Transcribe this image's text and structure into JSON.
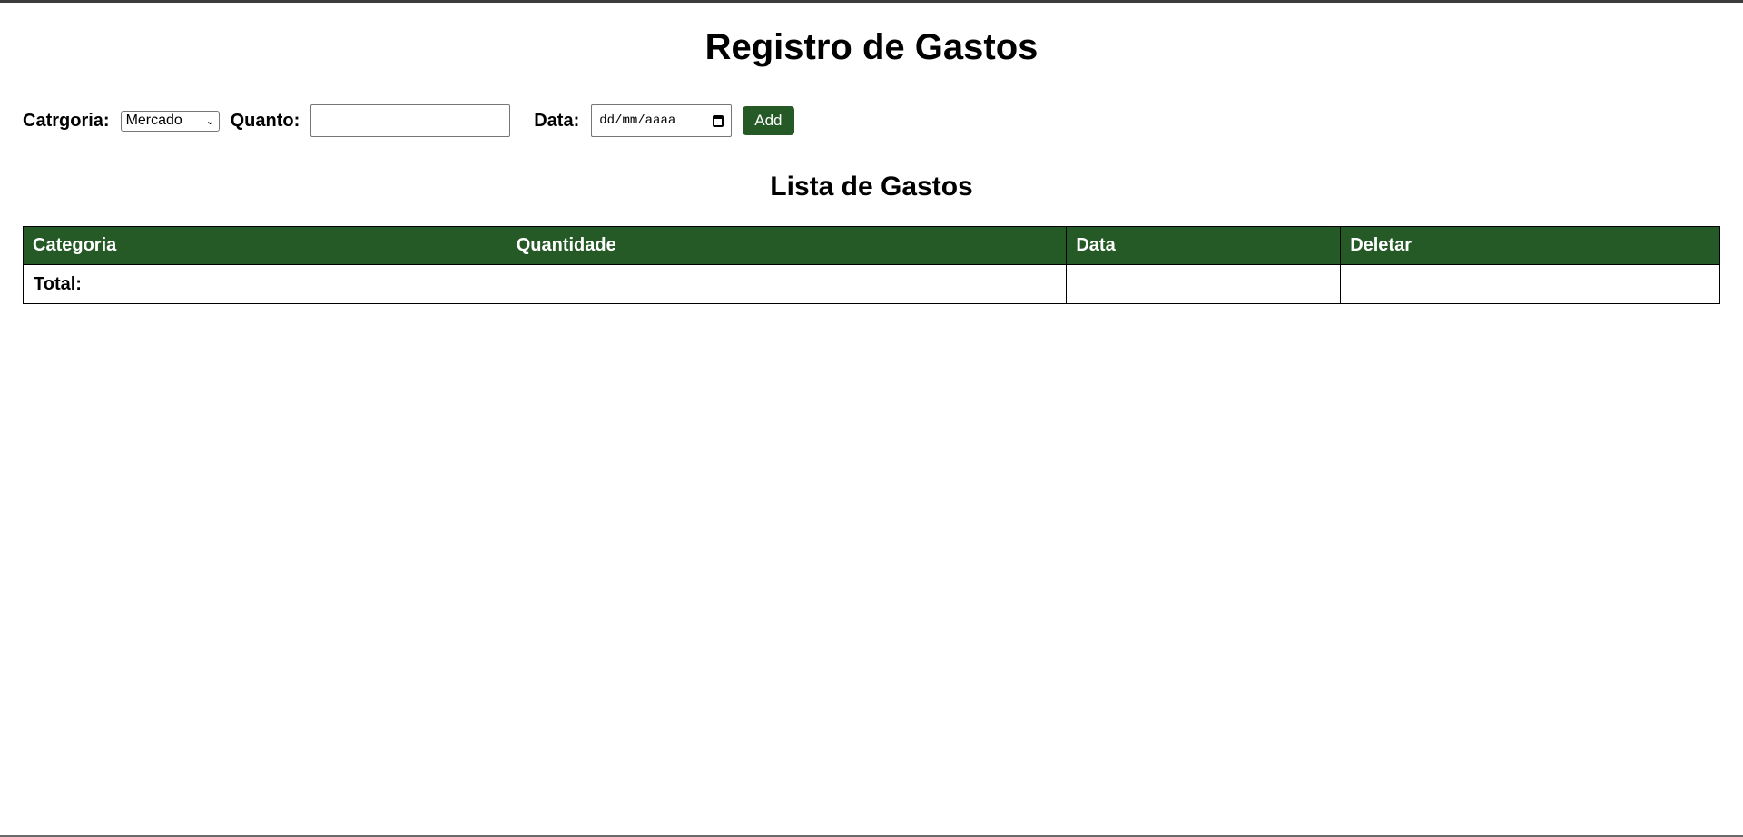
{
  "page": {
    "title": "Registro de Gastos",
    "accent_color": "#255a27"
  },
  "form": {
    "category_label": "Catrgoria:",
    "category_selected": "Mercado",
    "amount_label": "Quanto:",
    "amount_value": "",
    "date_label": "Data:",
    "date_placeholder": "dd/mm/aaaa",
    "add_label": "Add"
  },
  "list": {
    "title": "Lista de Gastos",
    "columns": [
      "Categoria",
      "Quantidade",
      "Data",
      "Deletar"
    ],
    "rows": [],
    "total_label": "Total:",
    "total_value": ""
  },
  "icons": {
    "select": "chevron-down-icon",
    "date": "calendar-icon"
  }
}
